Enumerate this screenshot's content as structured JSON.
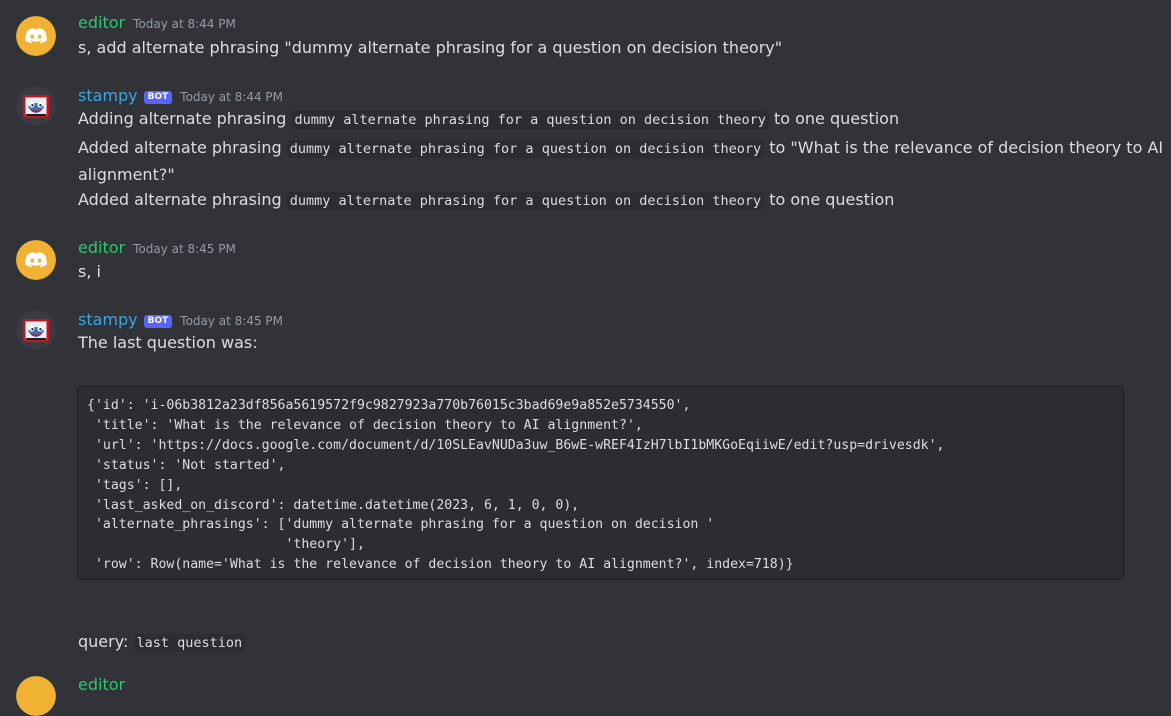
{
  "messages": [
    {
      "author": "editor",
      "timestamp": "Today at 8:44 PM",
      "lines": [
        "s, add alternate phrasing \"dummy alternate phrasing for a question on decision theory\""
      ]
    },
    {
      "author": "stampy",
      "bot_tag": "BOT",
      "timestamp": "Today at 8:44 PM",
      "line1": {
        "before": "Adding alternate phrasing",
        "code": "dummy alternate phrasing for a question on decision theory",
        "after": "to one question"
      },
      "line2": {
        "before": "Added alternate phrasing",
        "code": "dummy alternate phrasing for a question on decision theory",
        "after": "to \"What is the relevance of decision theory to AI alignment?\""
      },
      "line3": {
        "before": "Added alternate phrasing",
        "code": "dummy alternate phrasing for a question on decision theory",
        "after": "to one question"
      }
    },
    {
      "author": "editor",
      "timestamp": "Today at 8:45 PM",
      "lines": [
        "s, i"
      ]
    },
    {
      "author": "stampy",
      "bot_tag": "BOT",
      "timestamp": "Today at 8:45 PM",
      "intro": "The last question was:",
      "codeblock": "{'id': 'i-06b3812a23df856a5619572f9c9827923a770b76015c3bad69e9a852e5734550',\n 'title': 'What is the relevance of decision theory to AI alignment?',\n 'url': 'https://docs.google.com/document/d/10SLEavNUDa3uw_B6wE-wREF4IzH7lbI1bMKGoEqiiwE/edit?usp=drivesdk',\n 'status': 'Not started',\n 'tags': [],\n 'last_asked_on_discord': datetime.datetime(2023, 6, 1, 0, 0),\n 'alternate_phrasings': ['dummy alternate phrasing for a question on decision '\n                         'theory'],\n 'row': Row(name='What is the relevance of decision theory to AI alignment?', index=718)}",
      "query_label": "query:",
      "query_code": "last question"
    }
  ],
  "next_author_partial": "editor",
  "colors": {
    "background": "#313338",
    "editor_name": "#2dc770",
    "stampy_name": "#3ba5e3",
    "bot_tag": "#5865f2",
    "timestamp": "#949ba4",
    "codeblock_bg": "#2b2d31",
    "discord_avatar": "#f0b232"
  }
}
